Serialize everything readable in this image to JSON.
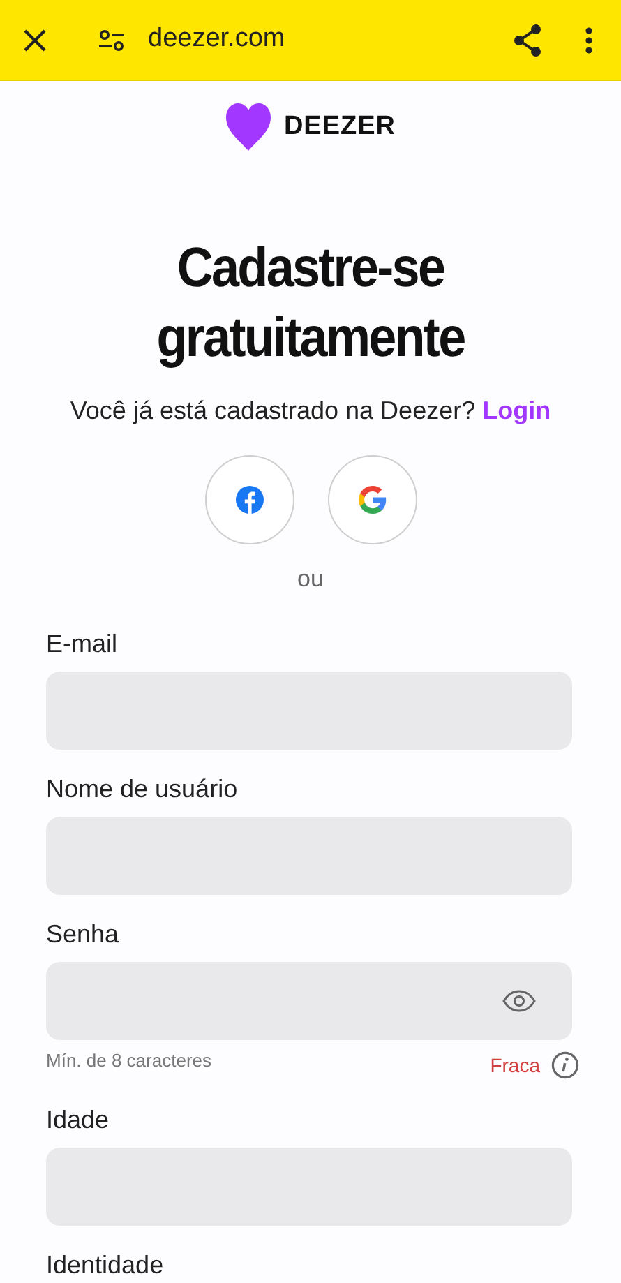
{
  "browser_bar": {
    "url": "deezer.com"
  },
  "logo": {
    "text": "DEEZER"
  },
  "title": [
    "Cadastre-se",
    "gratuitamente"
  ],
  "login_prompt": {
    "text": "Você já está cadastrado na Deezer?",
    "link": "Login"
  },
  "social_buttons": [
    {
      "kind": "facebook"
    },
    {
      "kind": "google"
    }
  ],
  "separator": "ou",
  "fields": [
    {
      "label": "E-mail",
      "kind": "text"
    },
    {
      "label": "Nome de usuário",
      "kind": "text"
    },
    {
      "label": "Senha",
      "kind": "password",
      "hint": "Mín. de 8 caracteres",
      "strength": "Fraca"
    },
    {
      "label": "Idade",
      "kind": "text"
    },
    {
      "label": "Identidade",
      "kind": "label"
    }
  ]
}
